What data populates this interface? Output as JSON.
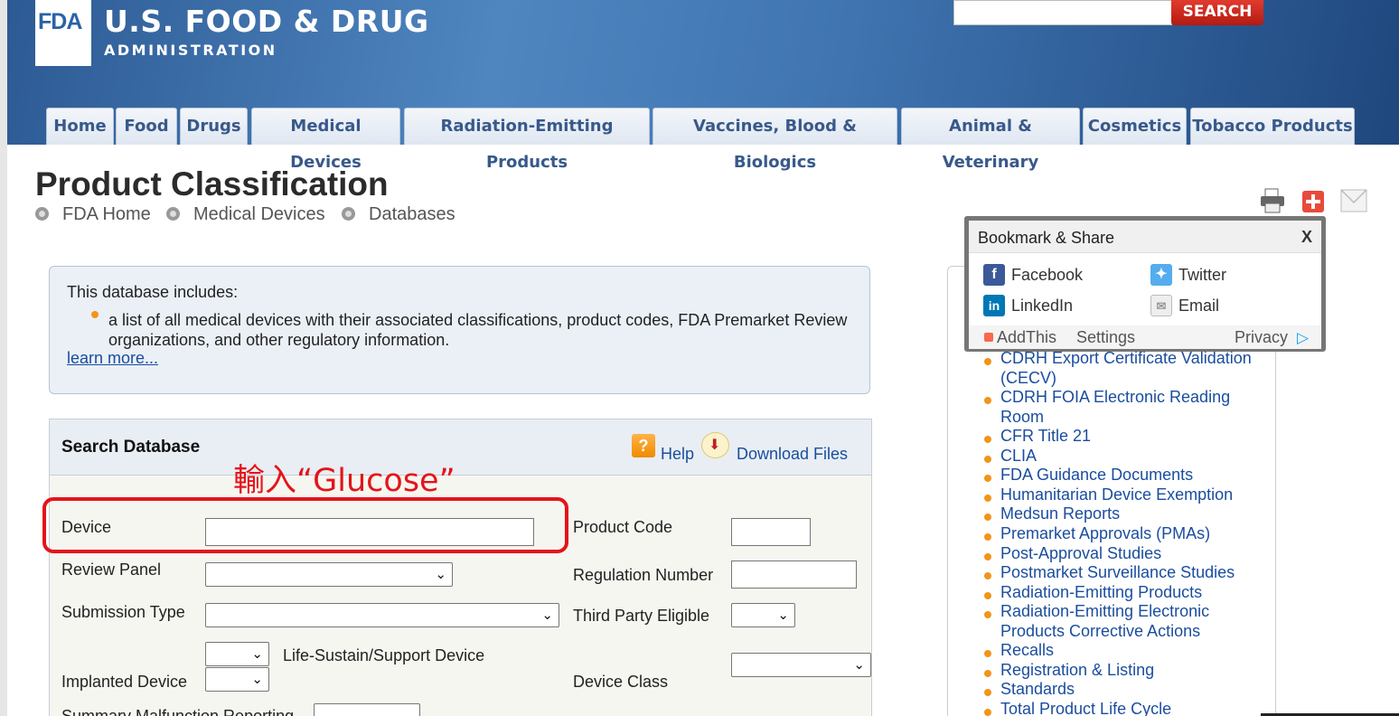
{
  "header": {
    "logo_mark": "FDA",
    "title": "U.S. FOOD & DRUG",
    "subtitle": "ADMINISTRATION",
    "search_button": "SEARCH",
    "brand_color": "#2d5a94"
  },
  "nav": {
    "tabs": [
      "Home",
      "Food",
      "Drugs",
      "Medical Devices",
      "Radiation-Emitting Products",
      "Vaccines, Blood & Biologics",
      "Animal & Veterinary",
      "Cosmetics",
      "Tobacco Products"
    ]
  },
  "page": {
    "title": "Product Classification",
    "breadcrumb": [
      "FDA Home",
      "Medical Devices",
      "Databases"
    ]
  },
  "info": {
    "intro": "This database includes:",
    "bullet": "a list of all medical devices with their associated classifications, product codes, FDA Premarket Review organizations, and other regulatory information.",
    "learn_more": "learn more..."
  },
  "search": {
    "heading": "Search Database",
    "help": "Help",
    "download": "Download Files",
    "annotation": "輸入“Glucose”",
    "fields": {
      "device": "Device",
      "device_value": "",
      "review_panel": "Review Panel",
      "submission_type": "Submission Type",
      "life_sustain": "Life-Sustain/Support Device",
      "implanted_device": "Implanted Device",
      "summary_malfunction": "Summary Malfunction Reporting",
      "product_code": "Product Code",
      "regulation_number": "Regulation Number",
      "third_party": "Third Party Eligible",
      "device_class": "Device Class"
    }
  },
  "bookmark": {
    "title": "Bookmark & Share",
    "close": "X",
    "facebook": "Facebook",
    "twitter": "Twitter",
    "linkedin": "LinkedIn",
    "email": "Email",
    "addthis": "AddThis",
    "settings": "Settings",
    "privacy": "Privacy"
  },
  "sidebar": {
    "items": [
      "CDRH Export Certificate Validation (CECV)",
      "CDRH FOIA Electronic Reading Room",
      "CFR Title 21",
      "CLIA",
      "FDA Guidance Documents",
      "Humanitarian Device Exemption",
      "Medsun Reports",
      "Premarket Approvals (PMAs)",
      "Post-Approval Studies",
      "Postmarket Surveillance Studies",
      "Radiation-Emitting Products",
      "Radiation-Emitting Electronic Products Corrective Actions",
      "Recalls",
      "Registration & Listing",
      "Standards",
      "Total Product Life Cycle"
    ]
  }
}
